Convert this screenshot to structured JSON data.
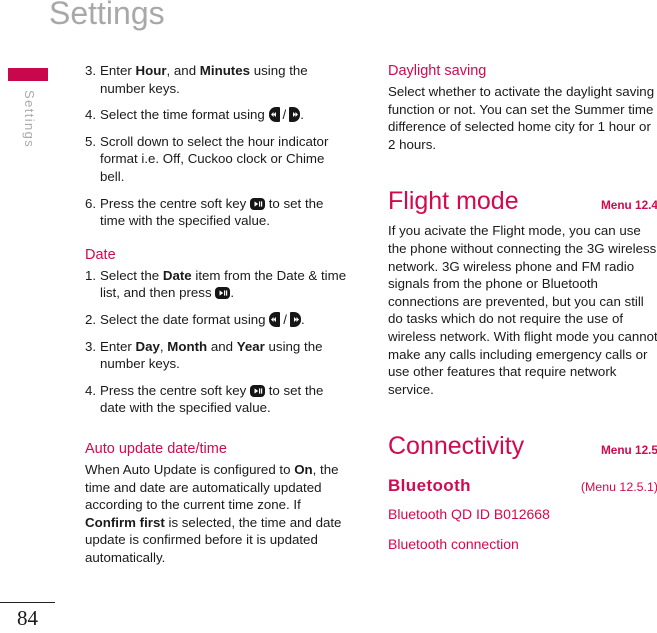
{
  "page": {
    "title": "Settings",
    "number": "84",
    "sidebar_label": "Settings",
    "accent_color": "#c8074d",
    "heading_color": "#d3094e",
    "title_color": "#a8a8a8"
  },
  "left_column": {
    "steps_time": [
      {
        "num": "3.",
        "pre": "Enter ",
        "b1": "Hour",
        "mid": ", and ",
        "b2": "Minutes",
        "post": " using the number keys."
      },
      {
        "num": "4.",
        "pre": "Select the time format using ",
        "post": "."
      },
      {
        "num": "5.",
        "pre": "Scroll down to select the hour indicator format i.e. Off, Cuckoo clock or Chime bell."
      },
      {
        "num": "6.",
        "pre": "Press the centre soft key ",
        "post": " to set the time with the specified value."
      }
    ],
    "date_heading": "Date",
    "steps_date": [
      {
        "num": "1.",
        "pre": "Select the ",
        "b1": "Date",
        "mid": " item from the Date & time list, and then press ",
        "post": "."
      },
      {
        "num": "2.",
        "pre": "Select the date format using ",
        "post": "."
      },
      {
        "num": "3.",
        "pre": "Enter ",
        "b1": "Day",
        "mid": ", ",
        "b2": "Month",
        "mid2": " and ",
        "b3": "Year",
        "post": " using the number keys."
      },
      {
        "num": "4.",
        "pre": "Press the centre soft key ",
        "post": " to set the date with the specified value."
      }
    ],
    "auto_update_heading": "Auto update date/time",
    "auto_update_body": {
      "p1": "When Auto Update is configured to ",
      "b1": "On",
      "p2": ", the time and date are automatically updated according to the current time zone. If ",
      "b2": "Confirm first",
      "p3": " is selected, the time and date update is confirmed before it is updated automatically."
    }
  },
  "right_column": {
    "daylight_heading": "Daylight saving",
    "daylight_body": "Select whether to activate the daylight saving function or not. You can set the Summer time difference of selected home city for 1 hour or 2 hours.",
    "flight_heading": "Flight mode",
    "flight_menu": "Menu 12.4",
    "flight_body": "If you acivate the Flight mode, you can use the phone without connecting the 3G wireless network. 3G wireless phone and FM radio signals from the phone or Bluetooth connections are prevented, but you can still do tasks which do not require the use of wireless network. With flight mode you cannot make any calls including emergency calls or use other features that require network service.",
    "connectivity_heading": "Connectivity",
    "connectivity_menu": "Menu 12.5",
    "bluetooth_heading": "Bluetooth",
    "bluetooth_menu": "(Menu 12.5.1)",
    "bluetooth_qd": "Bluetooth QD ID B012668",
    "bluetooth_connection": "Bluetooth connection"
  },
  "icons": {
    "left_key": "rewind-key-icon",
    "right_key": "fast-forward-key-icon",
    "centre_key": "centre-soft-key-icon",
    "separator": "/"
  }
}
